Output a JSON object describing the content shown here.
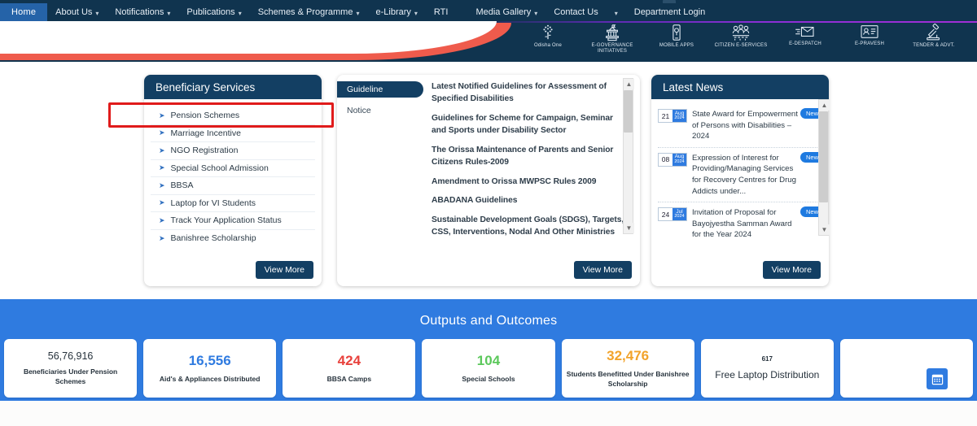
{
  "nav": {
    "home": "Home",
    "items": [
      {
        "label": "About Us",
        "caret": true
      },
      {
        "label": "Notifications",
        "caret": true
      },
      {
        "label": "Publications",
        "caret": true
      },
      {
        "label": "Schemes & Programme",
        "caret": true
      },
      {
        "label": "e-Library",
        "caret": true
      },
      {
        "label": "RTI",
        "caret": false
      },
      {
        "label": "Media Gallery",
        "caret": true
      },
      {
        "label": "Contact Us",
        "caret": false
      }
    ],
    "caret_standalone": "▾",
    "department_login": "Department Login"
  },
  "header_icons": [
    {
      "name": "odisha-one-icon",
      "label": "Odisha One"
    },
    {
      "name": "e-governance-initiatives-icon",
      "label": "E-GOVERNANCE INITIATIVES"
    },
    {
      "name": "mobile-apps-icon",
      "label": "MOBILE APPS"
    },
    {
      "name": "citizen-e-services-icon",
      "label": "CITIZEN E-SERVICES"
    },
    {
      "name": "e-despatch-icon",
      "label": "E-DESPATCH"
    },
    {
      "name": "e-pravesh-icon",
      "label": "E-PRAVESH"
    },
    {
      "name": "tender-advt-icon",
      "label": "TENDER & ADVT."
    }
  ],
  "beneficiary_services": {
    "title": "Beneficiary Services",
    "items": [
      "Pension Schemes",
      "Marriage Incentive",
      "NGO Registration",
      "Special School Admission",
      "BBSA",
      "Laptop for VI Students",
      "Track Your Application Status",
      "Banishree Scholarship"
    ],
    "view_more": "View More"
  },
  "guideline": {
    "tabs": [
      {
        "label": "Guideline",
        "active": true
      },
      {
        "label": "Notice",
        "active": false
      }
    ],
    "items": [
      "Latest Notified Guidelines for Assessment of Specified Disabilities",
      "Guidelines for Scheme for Campaign, Seminar and Sports under Disability Sector",
      "The Orissa Maintenance of Parents and Senior Citizens Rules-2009",
      "Amendment to Orissa MWPSC Rules 2009",
      "ABADANA Guidelines",
      "Sustainable Development Goals (SDGS), Targets, CSS, Interventions, Nodal And Other Ministries"
    ],
    "view_more": "View More"
  },
  "latest_news": {
    "title": "Latest News",
    "badge": "New",
    "items": [
      {
        "day": "21",
        "month": "Aug",
        "year": "2024",
        "text": "State Award for Empowerment of Persons with Disabilities – 2024"
      },
      {
        "day": "08",
        "month": "Aug",
        "year": "2024",
        "text": "Expression of Interest for Providing/Managing Services for Recovery Centres for Drug Addicts under..."
      },
      {
        "day": "24",
        "month": "Jul",
        "year": "2024",
        "text": "Invitation of Proposal for Bayojyestha Samman Award for the Year 2024"
      }
    ],
    "view_more": "View More"
  },
  "outputs": {
    "title": "Outputs and Outcomes",
    "stats": [
      {
        "value": "56,76,916",
        "label": "Beneficiaries Under Pension Schemes",
        "color": "#26323c",
        "style": "plain"
      },
      {
        "value": "16,556",
        "label": "Aid's & Appliances Distributed",
        "color": "#2f7be0",
        "style": "big"
      },
      {
        "value": "424",
        "label": "BBSA Camps",
        "color": "#e8413c",
        "style": "big"
      },
      {
        "value": "104",
        "label": "Special Schools",
        "color": "#5bc85b",
        "style": "big"
      },
      {
        "value": "32,476",
        "label": "Students Benefitted Under Banishree Scholarship",
        "color": "#f2a32b",
        "style": "big"
      },
      {
        "value": "617",
        "label": "Free Laptop Distribution",
        "color": "#26323c",
        "style": "tiny"
      },
      {
        "value": "",
        "label": "",
        "color": "#26323c",
        "style": "blank"
      }
    ],
    "calendar_button": "calendar-icon"
  },
  "colors": {
    "navy": "#10344f",
    "card_header": "#133f63",
    "accent_blue": "#2f7be0",
    "hero_red": "#ef5b4c",
    "annotation_red": "#e01b1b"
  }
}
